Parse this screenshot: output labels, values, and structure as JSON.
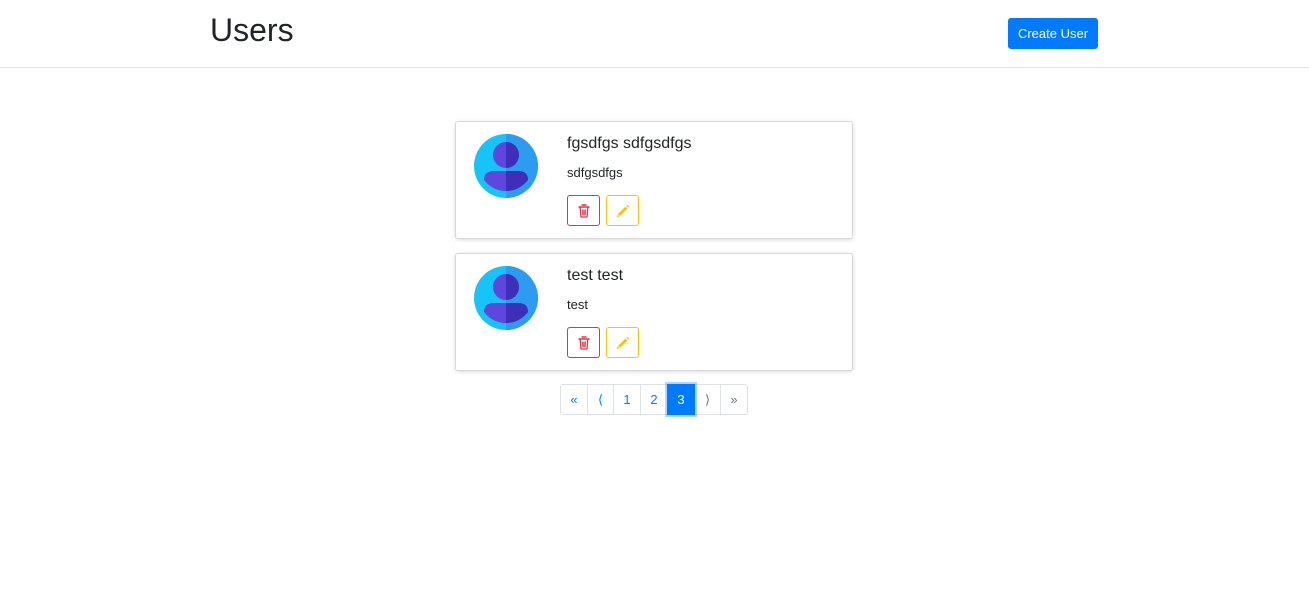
{
  "header": {
    "title": "Users",
    "create_label": "Create User"
  },
  "users": [
    {
      "name": "fgsdfgs sdfgsdfgs",
      "username": "sdfgsdfgs"
    },
    {
      "name": "test test",
      "username": "test"
    }
  ],
  "actions": {
    "delete_icon": "trash-icon",
    "edit_icon": "pencil-icon"
  },
  "pagination": {
    "first": "«",
    "prev": "⟨",
    "pages": [
      "1",
      "2",
      "3"
    ],
    "current": "3",
    "next": "⟩",
    "last": "»"
  },
  "colors": {
    "primary": "#007bff",
    "danger": "#dc3545",
    "warning": "#ffc107",
    "avatar_bg": "#1fb6f5",
    "avatar_figure": "#5a3fd8"
  }
}
